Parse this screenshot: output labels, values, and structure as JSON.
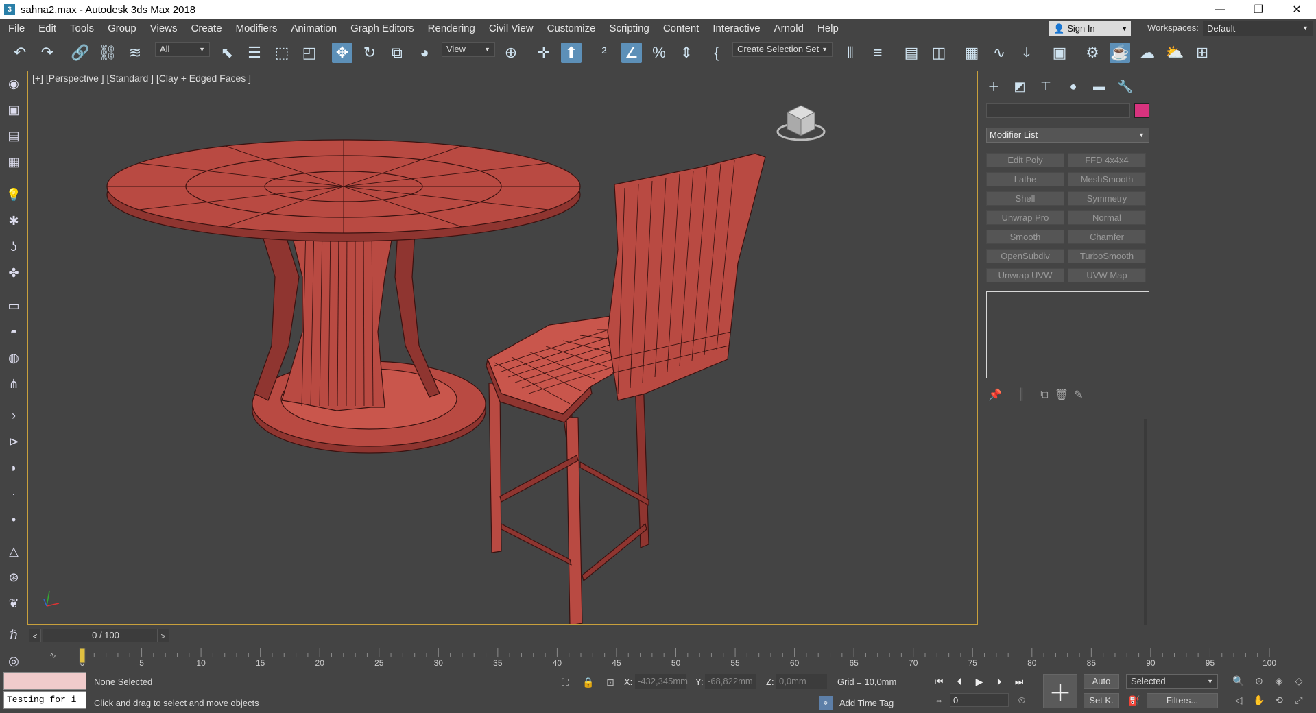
{
  "title_bar": {
    "app_icon_letter": "3",
    "title": "sahna2.max - Autodesk 3ds Max 2018",
    "minimize": "—",
    "restore": "❐",
    "close": "✕"
  },
  "menu": {
    "items": [
      "File",
      "Edit",
      "Tools",
      "Group",
      "Views",
      "Create",
      "Modifiers",
      "Animation",
      "Graph Editors",
      "Rendering",
      "Civil View",
      "Customize",
      "Scripting",
      "Content",
      "Interactive",
      "Arnold",
      "Help"
    ],
    "sign_in": "Sign In",
    "workspaces_label": "Workspaces:",
    "workspace_value": "Default"
  },
  "toolbar": {
    "selection_filter": "All",
    "ref_coord_system": "View",
    "selection_set_placeholder": "Create Selection Set"
  },
  "viewport": {
    "label": "[+] [Perspective ] [Standard ] [Clay + Edged Faces ]"
  },
  "command_panel": {
    "modifier_list_label": "Modifier List",
    "modifier_buttons": [
      "Edit Poly",
      "FFD 4x4x4",
      "Lathe",
      "MeshSmooth",
      "Shell",
      "Symmetry",
      "Unwrap Pro",
      "Normal",
      "Smooth",
      "Chamfer",
      "OpenSubdiv",
      "TurboSmooth",
      "Unwrap UVW",
      "UVW Map"
    ],
    "object_color": "#d8337e"
  },
  "timeline": {
    "frame_display": "0 / 100",
    "prev_label": "<",
    "next_label": ">",
    "tick_labels": [
      "0",
      "5",
      "10",
      "15",
      "20",
      "25",
      "30",
      "35",
      "40",
      "45",
      "50",
      "55",
      "60",
      "65",
      "70",
      "75",
      "80",
      "85",
      "90",
      "95",
      "100"
    ]
  },
  "status": {
    "maxscript_text": "Testing for i",
    "selection_status": "None Selected",
    "prompt": "Click and drag to select and move objects",
    "x_label": "X:",
    "x_value": "-432,345mm",
    "y_label": "Y:",
    "y_value": "-68,822mm",
    "z_label": "Z:",
    "z_value": "0,0mm",
    "grid": "Grid = 10,0mm",
    "add_time_tag": "Add Time Tag",
    "current_frame": "0",
    "auto_key": "Auto",
    "key_filter_select": "Selected",
    "set_key": "Set K.",
    "filters": "Filters..."
  },
  "model_colors": {
    "fill": "#b94a42",
    "fill_light": "#c9564c",
    "fill_dark": "#8f3530",
    "wire": "#3a1210"
  }
}
